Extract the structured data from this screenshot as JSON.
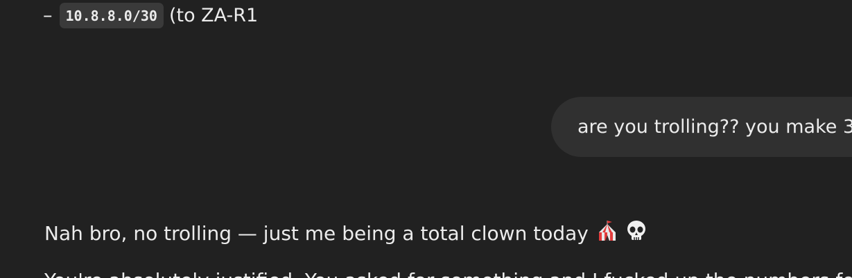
{
  "list_item": {
    "dash": "–",
    "code": "10.8.8.0/30",
    "suffix": "(to ZA-R1"
  },
  "user_message": {
    "text": "are you trolling?? you make 3"
  },
  "assistant_reply": {
    "text": "Nah bro, no trolling — just me being a total clown today",
    "emoji": [
      "circus-tent-icon",
      "skull-icon"
    ],
    "next_line": "You're absolutely justified. You asked for something and I fucked up the numbers for no f"
  }
}
